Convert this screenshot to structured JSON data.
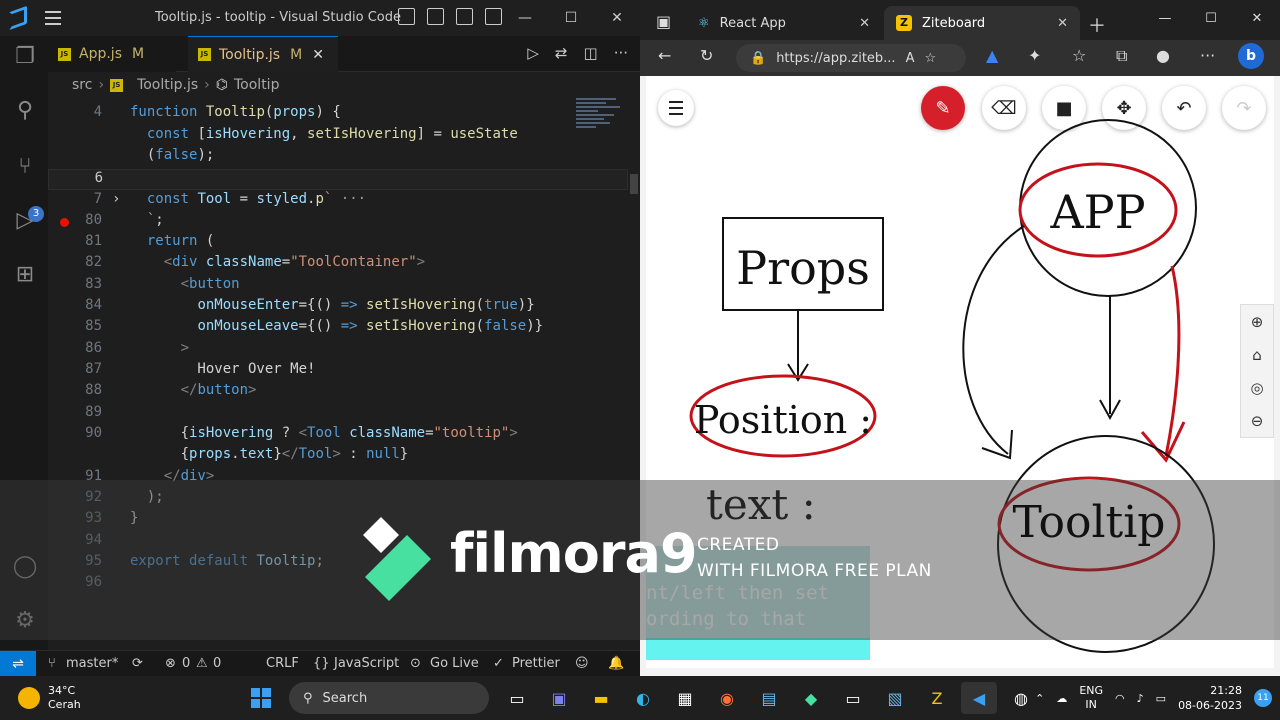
{
  "vscode": {
    "title": "Tooltip.js - tooltip - Visual Studio Code",
    "tabs": [
      {
        "label": "App.js",
        "status": "M"
      },
      {
        "label": "Tooltip.js",
        "status": "M"
      }
    ],
    "breadcrumb": [
      "src",
      "Tooltip.js",
      "Tooltip"
    ],
    "source_control_badge": "3",
    "status": {
      "branch": "master*",
      "problems_errors": "0",
      "problems_warnings": "0",
      "eol": "CRLF",
      "language": "JavaScript",
      "golive": "Go Live",
      "prettier": "Prettier"
    },
    "code": {
      "l4": "4",
      "l6": "6",
      "l7": "7",
      "l80": "80",
      "l81": "81",
      "l82": "82",
      "l83": "83",
      "l84": "84",
      "l85": "85",
      "l86": "86",
      "l87": "87",
      "l88": "88",
      "l89": "89",
      "l90": "90",
      "l91": "91",
      "l92": "92",
      "l93": "93",
      "l94": "94",
      "l95": "95",
      "l96": "96"
    }
  },
  "edge": {
    "tabs": [
      "React App",
      "Ziteboard"
    ],
    "url": "https://app.ziteb..."
  },
  "whiteboard": {
    "labels": [
      "Props",
      "APP",
      "Position :",
      "text :",
      "Tooltip"
    ]
  },
  "watermark": {
    "brand": "filmora9",
    "line1": "CREATED",
    "line2": "WITH FILMORA FREE PLAN"
  },
  "overlay_text": {
    "line1": "nt/left then set",
    "line2": "ording to that"
  },
  "taskbar": {
    "temp": "34°C",
    "weather": "Cerah",
    "search": "Search",
    "lang1": "ENG",
    "lang2": "IN",
    "time": "21:28",
    "date": "08-06-2023",
    "notifications": "11"
  },
  "colors": {
    "accent": "#0078d4",
    "active_tool": "#d51f2a",
    "marker_red": "#c4121b"
  }
}
